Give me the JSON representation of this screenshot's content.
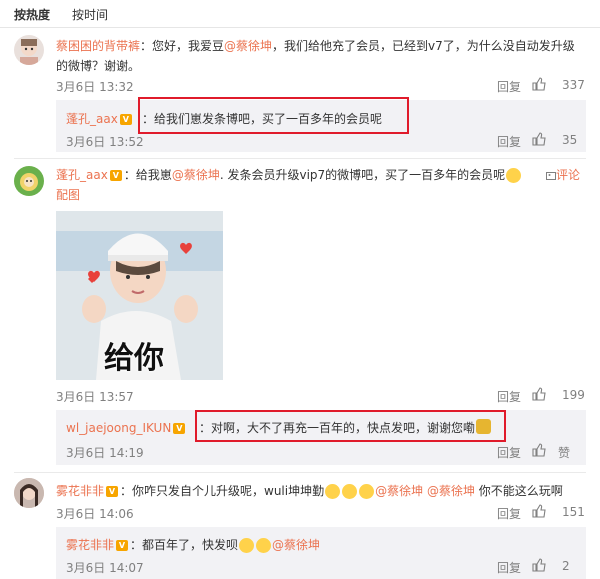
{
  "tabs": [
    "按热度",
    "按时间"
  ],
  "comments": [
    {
      "author": "蔡困困的背带裤",
      "text_prefix": "：您好，我爱豆",
      "mention": "@蔡徐坤",
      "text_suffix": "，我们给他充了会员，已经到v7了，为什么没自动发升级",
      "text_line2": "的微博？谢谢。",
      "time": "3月6日 13:32",
      "reply_label": "回复",
      "likes": "337"
    },
    {
      "author": "蓬孔_aax",
      "text": "：给我们崽发条博吧，买了一百多年的会员呢",
      "time": "3月6日 13:52",
      "reply_label": "回复",
      "likes": "35"
    },
    {
      "author": "蓬孔_aax",
      "text_prefix": "：给我崽",
      "mention": "@蔡徐坤",
      "text_suffix": ". 发条会员升级vip7的微博吧，买了一百多年的会员呢",
      "comment_link": "评论",
      "text_line2": "配图",
      "image_caption": "给你",
      "time": "3月6日 13:57",
      "reply_label": "回复",
      "likes": "199"
    },
    {
      "author": "wl_jaejoong_IKUN",
      "text": "：对啊，大不了再充一百年的，快点发吧，谢谢您嘞",
      "time": "3月6日 14:19",
      "reply_label": "回复",
      "likes": "赞"
    },
    {
      "author": "雾花非非",
      "text_prefix": "：你咋只发自个儿升级呢，wuli坤坤勤",
      "mention1": "@蔡徐坤",
      "mention2": "@蔡徐坤",
      "text_suffix": "你不能这么玩啊",
      "time": "3月6日 14:06",
      "reply_label": "回复",
      "likes": "151"
    },
    {
      "author": "雾花非非",
      "text_prefix": "：都百年了，快发呗",
      "mention": "@蔡徐坤",
      "time": "3月6日 14:07",
      "reply_label": "回复",
      "likes": "2"
    }
  ],
  "colors": {
    "name": "#eb7350",
    "highlight": "#e01b2b"
  }
}
